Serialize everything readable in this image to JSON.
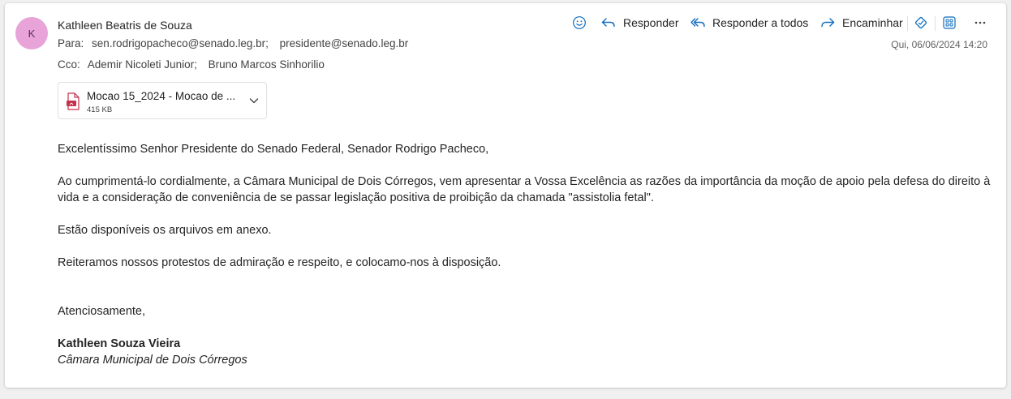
{
  "sender": {
    "initial": "K",
    "name": "Kathleen Beatris de Souza",
    "avatar_color": "#e8a4d8"
  },
  "to": {
    "label": "Para:",
    "recipients": [
      "sen.rodrigopacheco@senado.leg.br;",
      "presidente@senado.leg.br"
    ]
  },
  "cc": {
    "label": "Cco:",
    "recipients": [
      "Ademir Nicoleti Junior;",
      "Bruno Marcos Sinhorilio"
    ]
  },
  "date": "Qui, 06/06/2024 14:20",
  "toolbar": {
    "emoji_icon": "smiley-icon",
    "reply_label": "Responder",
    "reply_all_label": "Responder a todos",
    "forward_label": "Encaminhar",
    "accent": "#0f6cbd"
  },
  "attachment": {
    "name": "Mocao 15_2024 - Mocao de ...",
    "size": "415 KB",
    "icon": "pdf-icon",
    "icon_color": "#c4314b"
  },
  "body": {
    "greeting": "Excelentíssimo Senhor Presidente do Senado Federal, Senador Rodrigo Pacheco,",
    "paragraph1": "Ao cumprimentá-lo cordialmente, a Câmara Municipal de Dois Córregos, vem apresentar a Vossa Excelência as razões da importância da moção de apoio pela defesa do direito à vida e a consideração de conveniência de se passar legislação positiva de proibição da chamada \"assistolia fetal\".",
    "paragraph2": "Estão disponíveis os arquivos em anexo.",
    "paragraph3": "Reiteramos nossos protestos de admiração e respeito, e colocamo-nos à disposição.",
    "closing": "Atenciosamente,",
    "signature_name": "Kathleen Souza Vieira",
    "signature_org": "Câmara Municipal de Dois Córregos"
  }
}
